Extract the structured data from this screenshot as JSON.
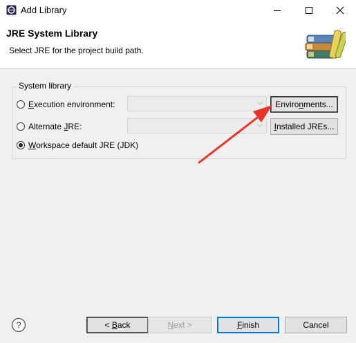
{
  "window": {
    "title": "Add Library",
    "icon": "eclipse-app-icon",
    "controls": {
      "minimize": "minimize-icon",
      "maximize": "maximize-icon",
      "close": "close-icon"
    }
  },
  "header": {
    "title": "JRE System Library",
    "description": "Select JRE for the project build path.",
    "image": "library-books-icon"
  },
  "system_library": {
    "group_label": "System library",
    "options": [
      {
        "label_prefix": "",
        "mnemonic": "E",
        "label_suffix": "xecution environment:",
        "selected": false
      },
      {
        "label_prefix": "Alternate ",
        "mnemonic": "J",
        "label_suffix": "RE:",
        "selected": false
      },
      {
        "label_prefix": "",
        "mnemonic": "W",
        "label_suffix": "orkspace default JRE (JDK)",
        "selected": true
      }
    ],
    "execution_env_combo": {
      "value": "",
      "enabled": false
    },
    "alternate_jre_combo": {
      "value": "",
      "enabled": false
    },
    "environments_button": {
      "prefix": "Enviro",
      "mnemonic": "n",
      "suffix": "ments..."
    },
    "installed_jres_button": {
      "prefix": "",
      "mnemonic": "I",
      "suffix": "nstalled JREs..."
    }
  },
  "footer": {
    "help_icon": "help-icon",
    "back_button": {
      "prefix": "< ",
      "mnemonic": "B",
      "suffix": "ack",
      "enabled": true
    },
    "next_button": {
      "prefix": "",
      "mnemonic": "N",
      "suffix": "ext >",
      "enabled": false
    },
    "finish_button": {
      "prefix": "",
      "mnemonic": "F",
      "suffix": "inish",
      "enabled": true
    },
    "cancel_button": {
      "label": "Cancel",
      "enabled": true
    }
  },
  "annotation": {
    "arrow_color": "#e8352c"
  },
  "colors": {
    "accent": "#0078d7",
    "dialog_bg": "#f0f0f0"
  }
}
